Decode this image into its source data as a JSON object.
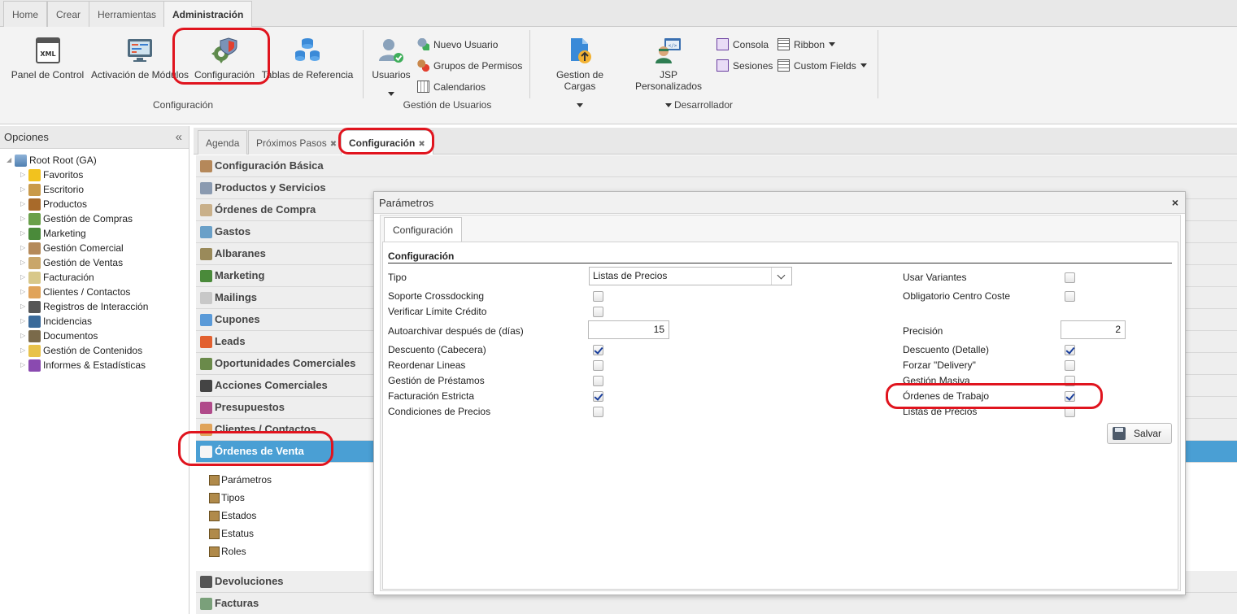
{
  "top_tabs": [
    "Home",
    "Crear",
    "Herramientas",
    "Administración"
  ],
  "ribbon": {
    "config_group": {
      "label": "Configuración",
      "buttons": [
        "Panel de Control",
        "Activación de Módulos",
        "Configuración",
        "Tablas de Referencia"
      ]
    },
    "users_group": {
      "label": "Gestión de Usuarios",
      "big_button": "Usuarios",
      "small_buttons": [
        "Nuevo Usuario",
        "Grupos de Permisos",
        "Calendarios"
      ]
    },
    "dev_group": {
      "label": "Desarrollador",
      "big_buttons": [
        "Gestion de Cargas",
        "JSP Personalizados"
      ],
      "small_buttons": [
        "Consola",
        "Sesiones",
        "Ribbon",
        "Custom Fields"
      ]
    }
  },
  "left_panel": {
    "title": "Opciones",
    "collapse_glyph": "«",
    "root": "Root Root (GA)",
    "items": [
      "Favoritos",
      "Escritorio",
      "Productos",
      "Gestión de Compras",
      "Marketing",
      "Gestión Comercial",
      "Gestión de Ventas",
      "Facturación",
      "Clientes / Contactos",
      "Registros de Interacción",
      "Incidencias",
      "Documentos",
      "Gestión de Contenidos",
      "Informes & Estadísticas"
    ]
  },
  "content_tabs": [
    "Agenda",
    "Próximos Pasos",
    "Configuración"
  ],
  "accordion": {
    "top": [
      "Configuración Básica",
      "Productos y Servicios",
      "Órdenes de Compra",
      "Gastos",
      "Albaranes",
      "Marketing",
      "Mailings",
      "Cupones",
      "Leads",
      "Oportunidades Comerciales",
      "Acciones Comerciales",
      "Presupuestos",
      "Clientes / Contactos"
    ],
    "active": "Órdenes de Venta",
    "sub_items": [
      "Parámetros",
      "Tipos",
      "Estados",
      "Estatus",
      "Roles"
    ],
    "bottom": [
      "Devoluciones",
      "Facturas"
    ]
  },
  "dialog": {
    "title": "Parámetros",
    "close_glyph": "×",
    "tab": "Configuración",
    "section": "Configuración",
    "left_fields": {
      "tipo_label": "Tipo",
      "tipo_value": "Listas de Precios",
      "crossdocking": "Soporte Crossdocking",
      "limite_credito": "Verificar Límite Crédito",
      "autoarchivar": "Autoarchivar después de (días)",
      "autoarchivar_value": "15",
      "descuento_cabecera": "Descuento (Cabecera)",
      "reordenar": "Reordenar Lineas",
      "prestamos": "Gestión de Préstamos",
      "facturacion_estricta": "Facturación Estricta",
      "condiciones": "Condiciones de Precios"
    },
    "right_fields": {
      "variantes": "Usar Variantes",
      "centro_coste": "Obligatorio Centro Coste",
      "precision": "Precisión",
      "precision_value": "2",
      "descuento_detalle": "Descuento (Detalle)",
      "delivery": "Forzar \"Delivery\"",
      "gestion_masiva": "Gestión Masiva",
      "ordenes_trabajo": "Órdenes de Trabajo",
      "listas_precios": "Listas de Precios"
    },
    "save_button": "Salvar"
  },
  "colors": {
    "active_row": "#4a9fd4",
    "annotation": "#e0141e",
    "check": "#1a3f9c"
  }
}
